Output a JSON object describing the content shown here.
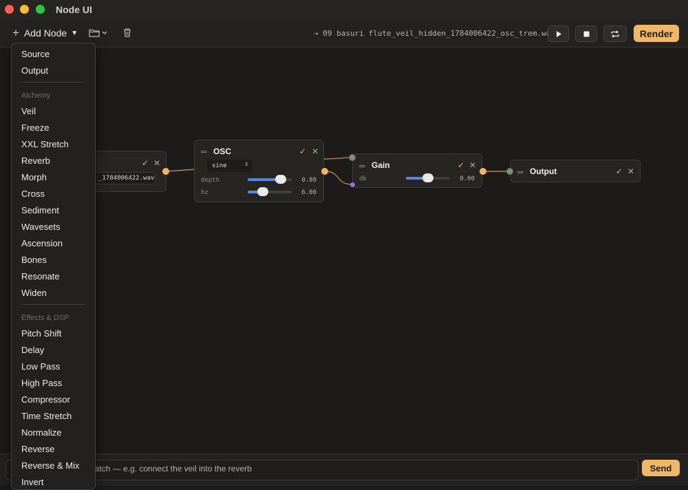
{
  "window": {
    "title": "Node UI"
  },
  "toolbar": {
    "add_node_label": "Add Node",
    "current_file": "→ 09 basuri flute_veil_hidden_1784006422_osc_trem.wav",
    "render_label": "Render"
  },
  "menu": {
    "top_items": [
      "Source",
      "Output"
    ],
    "alchemy_header": "Alchemy",
    "alchemy_items": [
      "Veil",
      "Freeze",
      "XXL Stretch",
      "Reverb",
      "Morph",
      "Cross",
      "Sediment",
      "Wavesets",
      "Ascension",
      "Bones",
      "Resonate",
      "Widen"
    ],
    "effects_header": "Effects & DSP",
    "effects_items": [
      "Pitch Shift",
      "Delay",
      "Low Pass",
      "High Pass",
      "Compressor",
      "Time Stretch",
      "Normalize",
      "Reverse",
      "Reverse & Mix",
      "Invert"
    ]
  },
  "nodes": {
    "source": {
      "file": "_1784006422.wav"
    },
    "osc": {
      "title": "OSC",
      "waveform": "sine",
      "params": [
        {
          "name": "depth",
          "value": "0.80",
          "fraction": 0.75
        },
        {
          "name": "hz",
          "value": "6.00",
          "fraction": 0.35
        }
      ]
    },
    "gain": {
      "title": "Gain",
      "params": [
        {
          "name": "db",
          "value": "0.00",
          "fraction": 0.5
        }
      ]
    },
    "output": {
      "title": "Output"
    }
  },
  "chat": {
    "placeholder": "patch — e.g. connect the veil into the reverb",
    "send_label": "Send"
  },
  "colors": {
    "accent": "#f0b865",
    "slider": "#4f86f0",
    "port_orange": "#f0b460",
    "port_purple": "#9a6ee0"
  }
}
